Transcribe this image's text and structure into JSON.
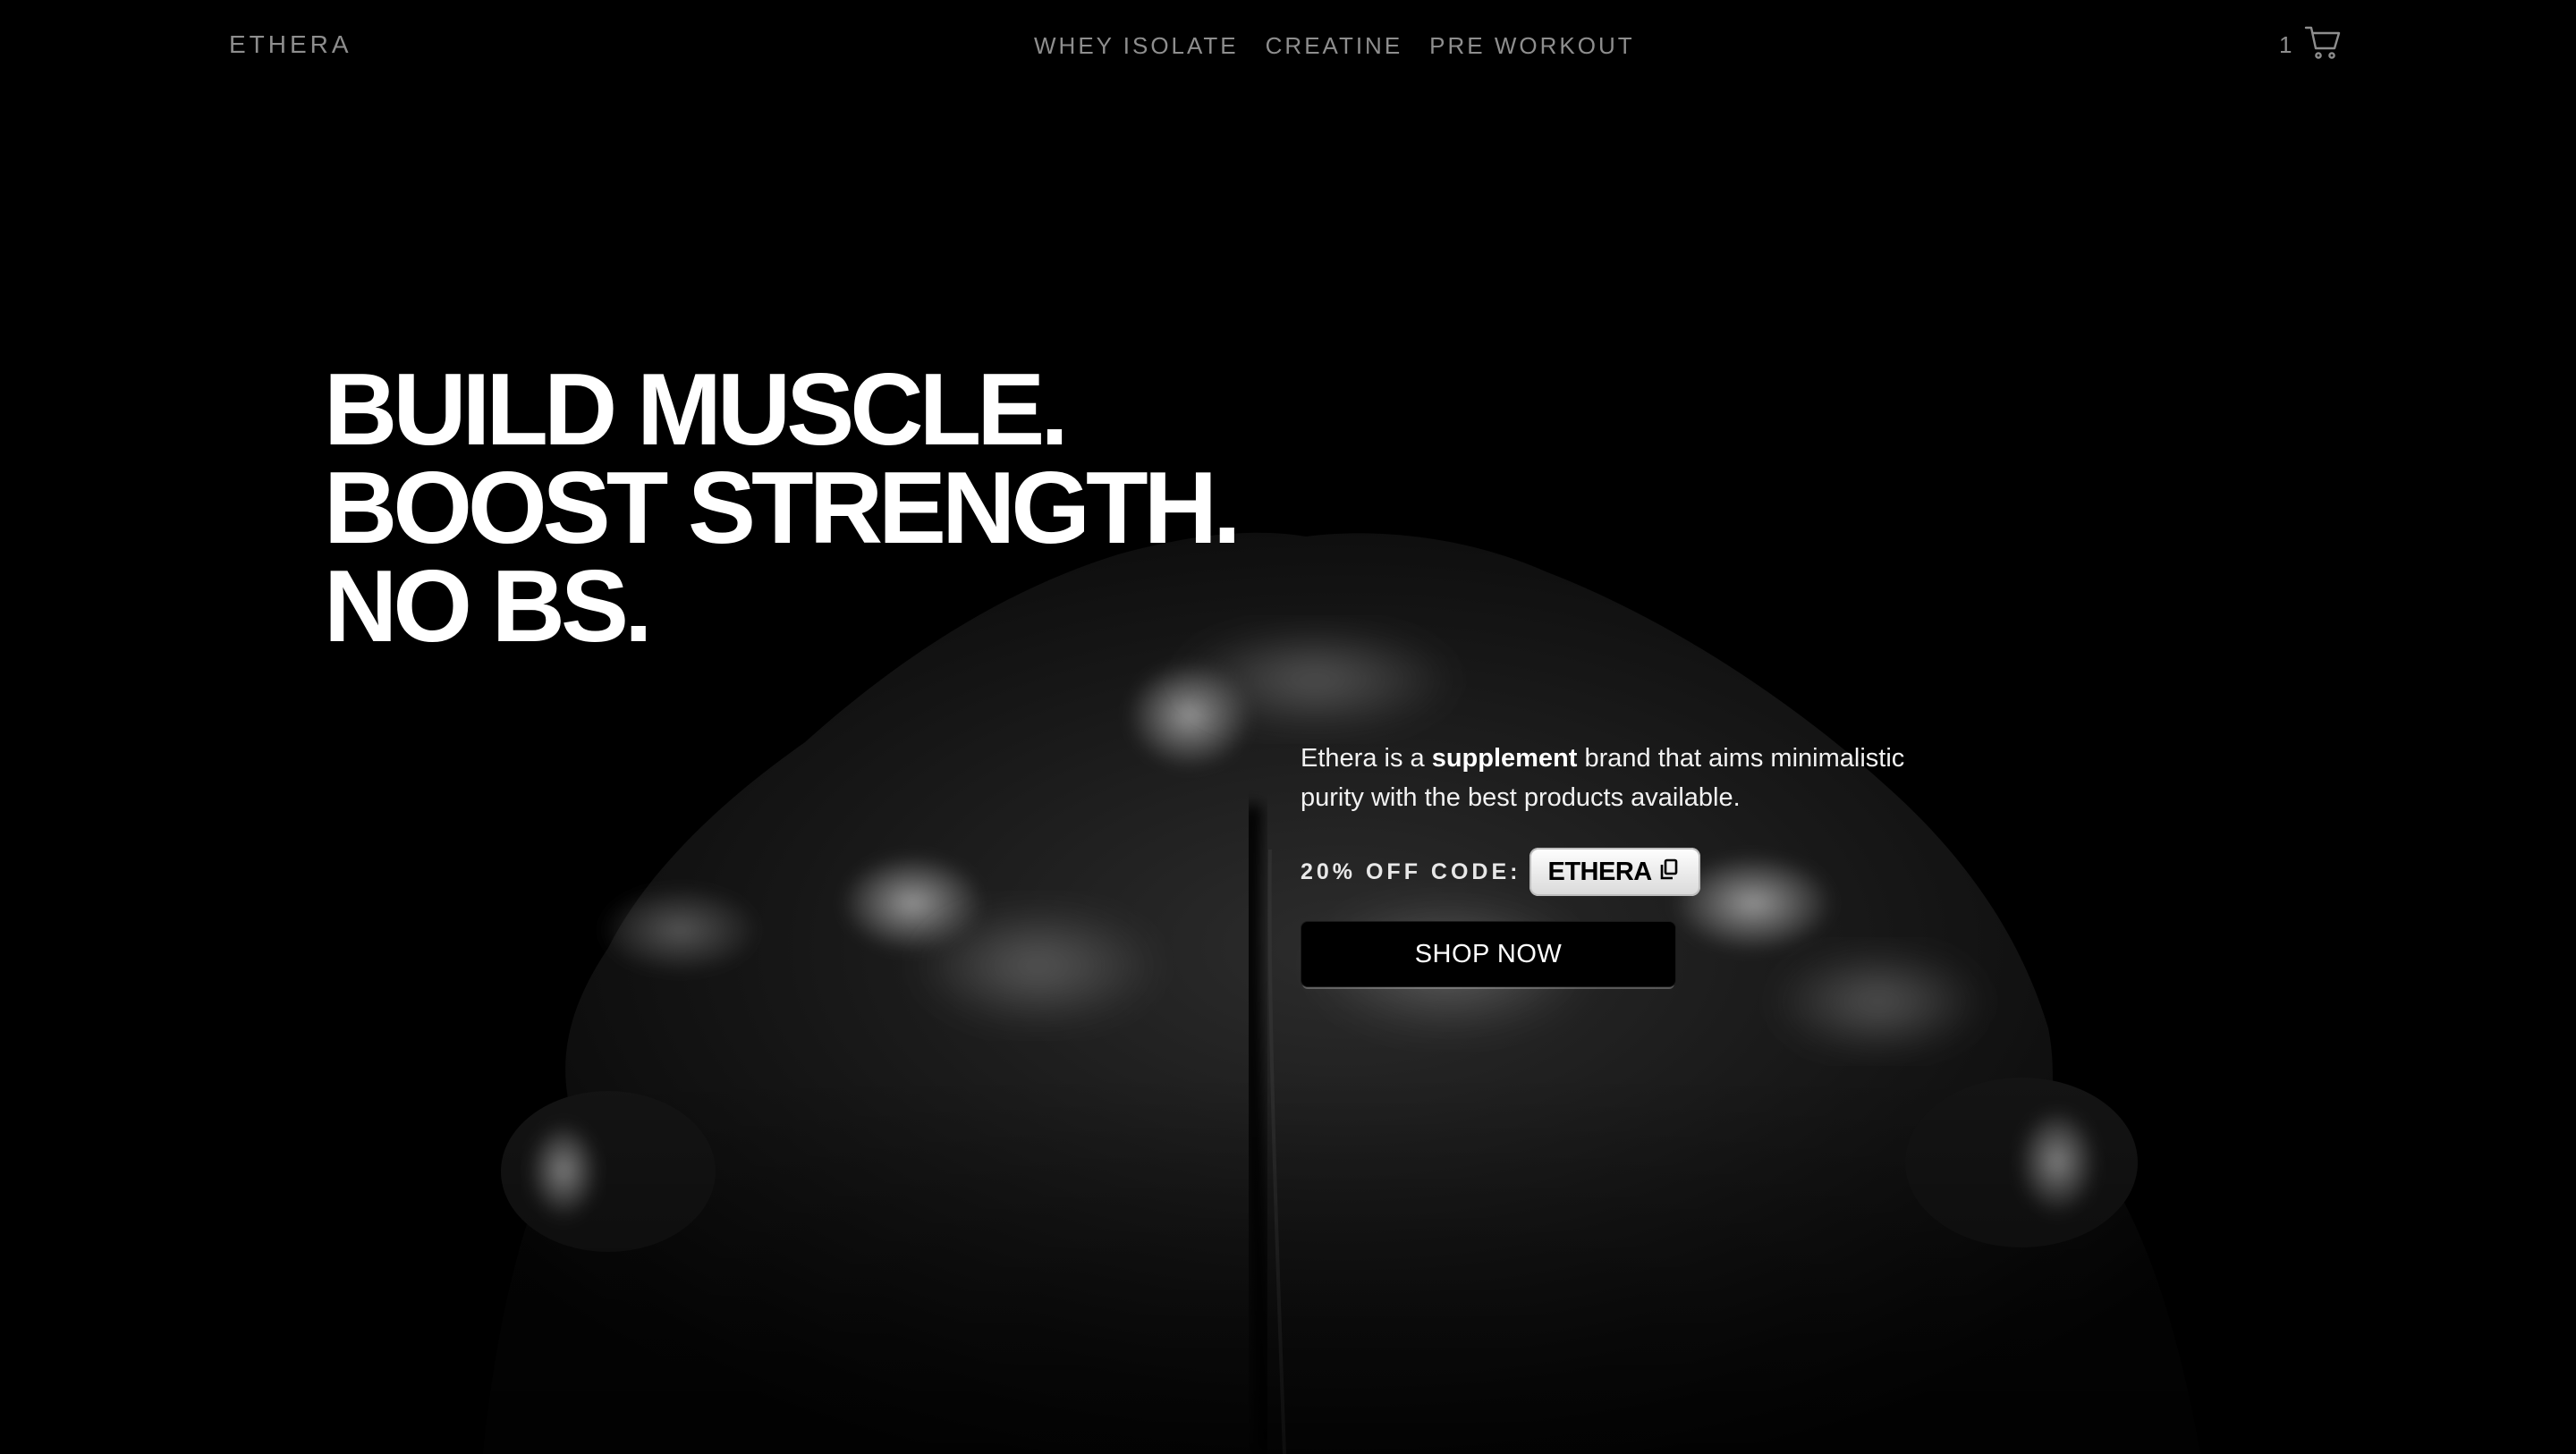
{
  "nav": {
    "logo": "ETHERA",
    "links": [
      "WHEY ISOLATE",
      "CREATINE",
      "PRE WORKOUT"
    ],
    "cart_count": "1",
    "cart_icon": "cart-icon"
  },
  "hero": {
    "headline": [
      "BUILD MUSCLE.",
      "BOOST STRENGTH.",
      "NO BS."
    ],
    "description": {
      "before": "Ethera is a ",
      "bold": "supplement",
      "after": " brand that aims minimalistic purity with the best products available."
    },
    "code_label": "20% OFF CODE:",
    "code": "ETHERA",
    "copy_icon": "copy-icon",
    "cta": "SHOP NOW"
  },
  "colors": {
    "background": "#000000",
    "nav_text": "#8e8e8e",
    "headline": "#ffffff"
  }
}
